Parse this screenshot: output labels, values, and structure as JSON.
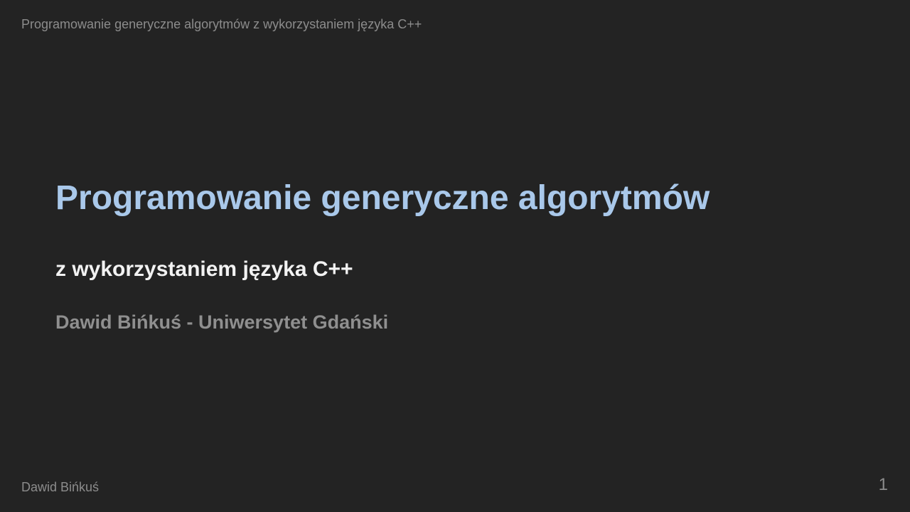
{
  "header": {
    "text": "Programowanie generyczne algorytmów z wykorzystaniem języka C++"
  },
  "slide": {
    "title": "Programowanie generyczne algorytmów",
    "subtitle": "z wykorzystaniem języka C++",
    "author_affiliation": "Dawid Bińkuś - Uniwersytet Gdański"
  },
  "footer": {
    "author": "Dawid Bińkuś",
    "page_number": "1"
  },
  "colors": {
    "background": "#232323",
    "title": "#a9c8ea",
    "subtitle": "#f2f2f2",
    "muted_text": "#8c8c8c"
  }
}
